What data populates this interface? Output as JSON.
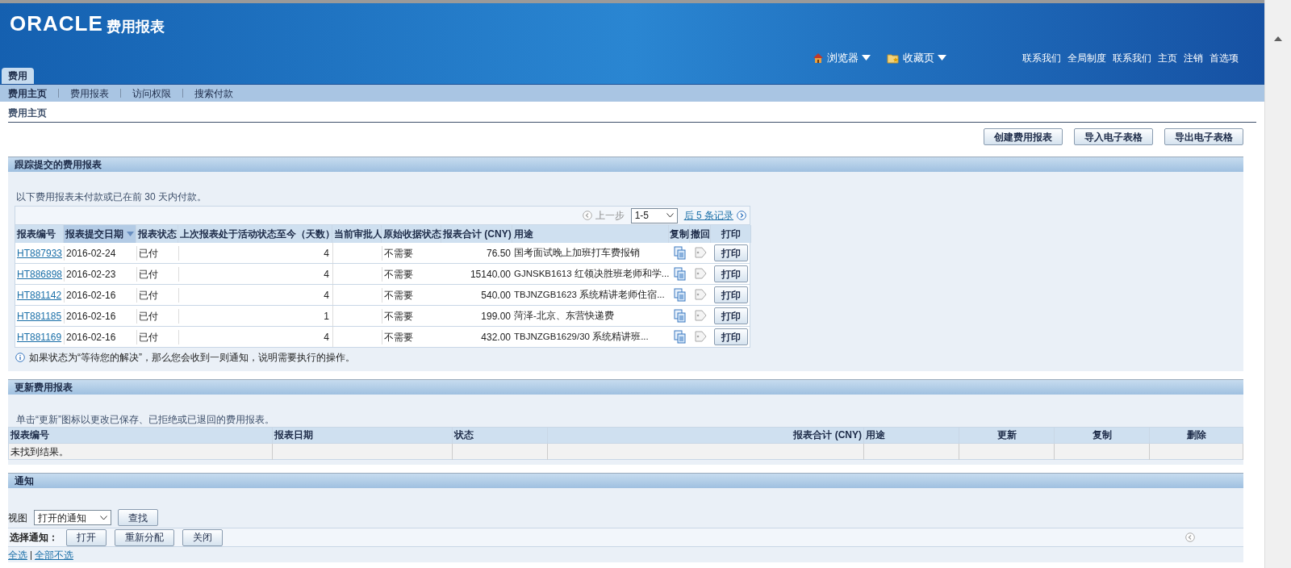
{
  "header": {
    "logo": "ORACLE",
    "app_title": "费用报表",
    "menus": [
      {
        "label": "浏览器",
        "kind": "home"
      },
      {
        "label": "收藏页",
        "kind": "favorites"
      }
    ],
    "global_links": [
      "联系我们",
      "全局制度",
      "联系我们",
      "主页",
      "注销",
      "首选项"
    ],
    "tabs": [
      {
        "label": "费用",
        "selected": true
      }
    ]
  },
  "subnav": [
    {
      "label": "费用主页",
      "selected": true
    },
    {
      "label": "费用报表",
      "selected": false
    },
    {
      "label": "访问权限",
      "selected": false
    },
    {
      "label": "搜索付款",
      "selected": false
    }
  ],
  "page_title": "费用主页",
  "actions": [
    "创建费用报表",
    "导入电子表格",
    "导出电子表格"
  ],
  "tracking": {
    "title": "跟踪提交的费用报表",
    "note": "以下费用报表未付款或已在前 30 天内付款。",
    "pager": {
      "prev": "上一步",
      "range": "1-5",
      "next": "后 5 条记录"
    },
    "columns": [
      {
        "label": "报表编号",
        "sorted": false
      },
      {
        "label": "报表提交日期",
        "sorted": true
      },
      {
        "label": "报表状态",
        "sorted": false
      },
      {
        "label": "上次报表处于活动状态至今（天数）",
        "sorted": false
      },
      {
        "label": "当前审批人",
        "sorted": false
      },
      {
        "label": "原始收据状态",
        "sorted": false
      },
      {
        "label": "报表合计 (CNY)",
        "sorted": false
      },
      {
        "label": "用途",
        "sorted": false
      },
      {
        "label": "复制",
        "sorted": false
      },
      {
        "label": "撤回",
        "sorted": false
      },
      {
        "label": "打印",
        "sorted": false
      }
    ],
    "rows": [
      {
        "id": "HT887933",
        "date": "2016-02-24",
        "status": "已付",
        "days": "4",
        "receipt": "不需要",
        "total": "76.50",
        "purpose": "国考面试晚上加班打车费报销",
        "withdraw_disabled": true,
        "print": "打印"
      },
      {
        "id": "HT886898",
        "date": "2016-02-23",
        "status": "已付",
        "days": "4",
        "receipt": "不需要",
        "total": "15140.00",
        "purpose": "GJNSKB1613 红领决胜班老师和学...",
        "withdraw_disabled": true,
        "print": "打印"
      },
      {
        "id": "HT881142",
        "date": "2016-02-16",
        "status": "已付",
        "days": "4",
        "receipt": "不需要",
        "total": "540.00",
        "purpose": "TBJNZGB1623 系统精讲老师住宿...",
        "withdraw_disabled": true,
        "print": "打印"
      },
      {
        "id": "HT881185",
        "date": "2016-02-16",
        "status": "已付",
        "days": "1",
        "receipt": "不需要",
        "total": "199.00",
        "purpose": "菏泽-北京、东营快递费",
        "withdraw_disabled": true,
        "print": "打印"
      },
      {
        "id": "HT881169",
        "date": "2016-02-16",
        "status": "已付",
        "days": "4",
        "receipt": "不需要",
        "total": "432.00",
        "purpose": "TBJNZGB1629/30 系统精讲班...",
        "withdraw_disabled": true,
        "print": "打印"
      }
    ],
    "tip": "如果状态为“等待您的解决”，那么您会收到一则通知，说明需要执行的操作。"
  },
  "update": {
    "title": "更新费用报表",
    "note": "单击“更新”图标以更改已保存、已拒绝或已退回的费用报表。",
    "columns": [
      "报表编号",
      "报表日期",
      "状态",
      "报表合计 (CNY)",
      "用途",
      "更新",
      "复制",
      "删除"
    ],
    "empty": "未找到结果。"
  },
  "notifications": {
    "title": "通知",
    "view_label": "视图",
    "view_value": "打开的通知",
    "find": "查找",
    "select_label": "选择通知：",
    "buttons": [
      "打开",
      "重新分配",
      "关闭"
    ],
    "select_links": [
      "全选",
      "全部不选"
    ]
  }
}
